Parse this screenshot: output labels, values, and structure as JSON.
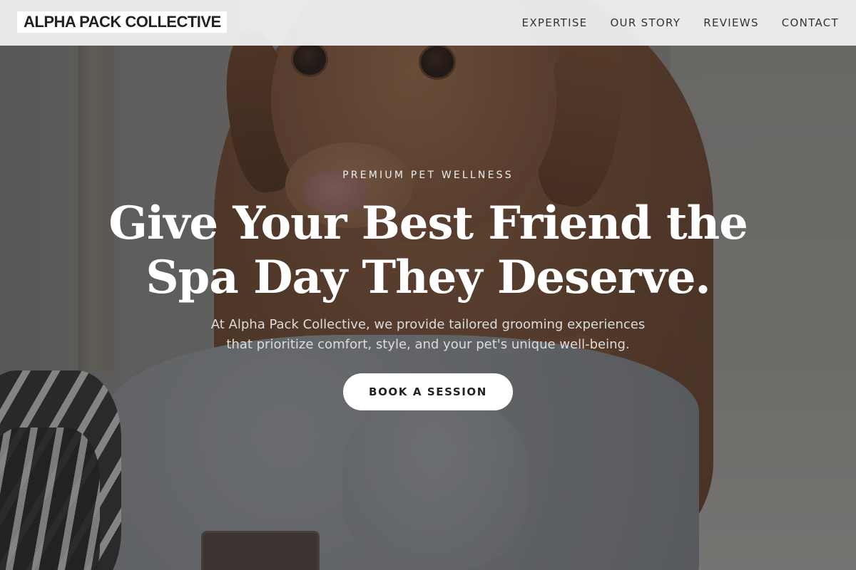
{
  "header": {
    "logo": "ALPHA PACK COLLECTIVE",
    "nav": [
      {
        "label": "EXPERTISE"
      },
      {
        "label": "OUR STORY"
      },
      {
        "label": "REVIEWS"
      },
      {
        "label": "CONTACT"
      }
    ]
  },
  "hero": {
    "eyebrow": "PREMIUM PET WELLNESS",
    "headline_line1": "Give Your Best Friend the",
    "headline_line2": "Spa Day They Deserve.",
    "description_line1": "At Alpha Pack Collective, we provide tailored grooming experiences",
    "description_line2": "that prioritize comfort, style, and your pet's unique well-being.",
    "cta_label": "BOOK A SESSION",
    "background_image": "dog-with-towel-photo"
  },
  "colors": {
    "header_bg": "#f2f2f1",
    "overlay": "#262626",
    "text_light": "#ffffff",
    "button_bg": "#ffffff",
    "button_text": "#222222"
  }
}
